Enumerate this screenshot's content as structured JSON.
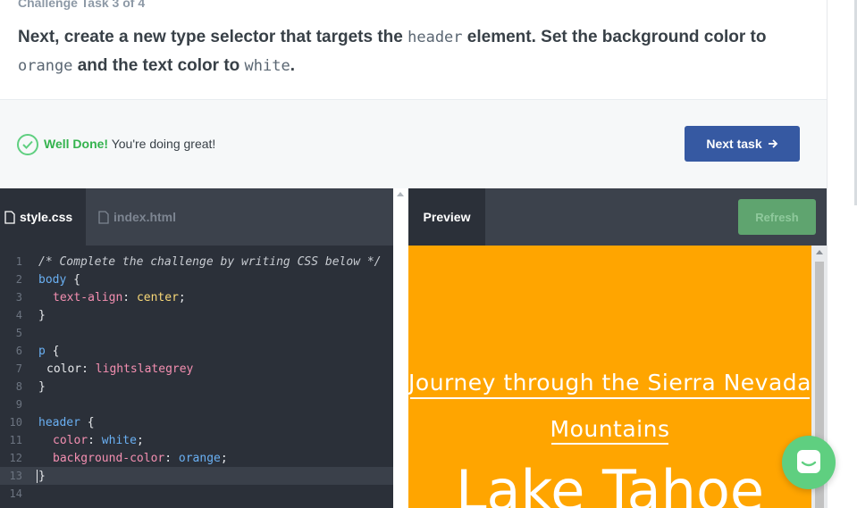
{
  "task": {
    "label": "Challenge Task 3 of 4",
    "text_1": "Next, create a new type selector that targets the ",
    "code_1": "header",
    "text_2": " element. Set the background color to ",
    "code_2": "orange",
    "text_3": " and the text color to ",
    "code_3": "white",
    "text_4": "."
  },
  "feedback": {
    "icon": "check-circle-icon",
    "bold": "Well Done!",
    "message": " You're doing great!",
    "next_label": "Next task",
    "next_icon": "arrow-right-icon"
  },
  "editor": {
    "tabs": [
      {
        "label": "style.css",
        "active": true
      },
      {
        "label": "index.html",
        "active": false
      }
    ],
    "lines": [
      {
        "n": "1"
      },
      {
        "n": "2"
      },
      {
        "n": "3"
      },
      {
        "n": "4"
      },
      {
        "n": "5"
      },
      {
        "n": "6"
      },
      {
        "n": "7"
      },
      {
        "n": "8"
      },
      {
        "n": "9"
      },
      {
        "n": "10"
      },
      {
        "n": "11"
      },
      {
        "n": "12"
      },
      {
        "n": "13"
      },
      {
        "n": "14"
      }
    ],
    "code": {
      "comment": "/* Complete the challenge by writing CSS below */",
      "body_sel": "body",
      "text_align_prop": "text-align",
      "text_align_val": "center",
      "p_sel": "p",
      "p_color_prop": "color",
      "p_color_val": "lightslategrey",
      "header_sel": "header",
      "h_color_prop": "color",
      "h_color_val": "white",
      "h_bg_prop": "background-color",
      "h_bg_val": "orange"
    }
  },
  "preview": {
    "tab_label": "Preview",
    "refresh_label": "Refresh",
    "title_line_1": "Journey through the Sierra Nevada",
    "title_line_2": "Mountains",
    "big_heading": "Lake Tahoe"
  },
  "colors": {
    "primary_button": "#3659a2",
    "success": "#5fcf80",
    "preview_header_bg": "#ffa500"
  }
}
